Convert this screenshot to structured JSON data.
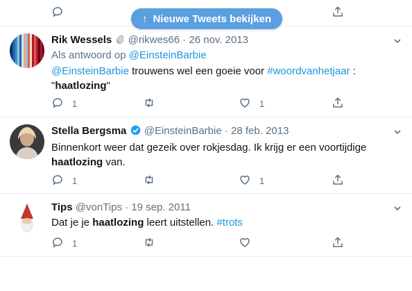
{
  "banner": {
    "label": "Nieuwe Tweets bekijken"
  },
  "tweets": [
    {
      "name": "Rik Wessels",
      "handle": "@rikwes66",
      "sep": "·",
      "date": "26 nov. 2013",
      "reply_prefix": "Als antwoord op",
      "reply_to": "@EinsteinBarbie",
      "text": {
        "mention": "@EinsteinBarbie",
        "t1": " trouwens  wel een goeie  voor ",
        "hashtag": "#woordvanhetjaar",
        "t2": " :",
        "q1": "\"",
        "bold": "haatlozing",
        "q2": "\""
      },
      "replies": "1",
      "likes": "1"
    },
    {
      "name": "Stella Bergsma",
      "handle": "@EinsteinBarbie",
      "sep": "·",
      "date": "28 feb. 2013",
      "text": {
        "t1": "Binnenkort weer dat gezeik over rokjesdag. Ik krijg er een voortijdige",
        "bold": "haatlozing",
        "t2": " van."
      },
      "replies": "1",
      "likes": "1"
    },
    {
      "name": "Tips",
      "handle": "@vonTips",
      "sep": "·",
      "date": "19 sep. 2011",
      "text": {
        "t1": "Dat je je ",
        "bold": "haatlozing",
        "t2": " leert uitstellen. ",
        "hashtag": "#trots"
      },
      "replies": "1",
      "likes": ""
    }
  ],
  "colors": {
    "link": "#1b95e0",
    "muted": "#5b7083",
    "verified": "#1da1f2",
    "banner": "#5a9fe0"
  }
}
